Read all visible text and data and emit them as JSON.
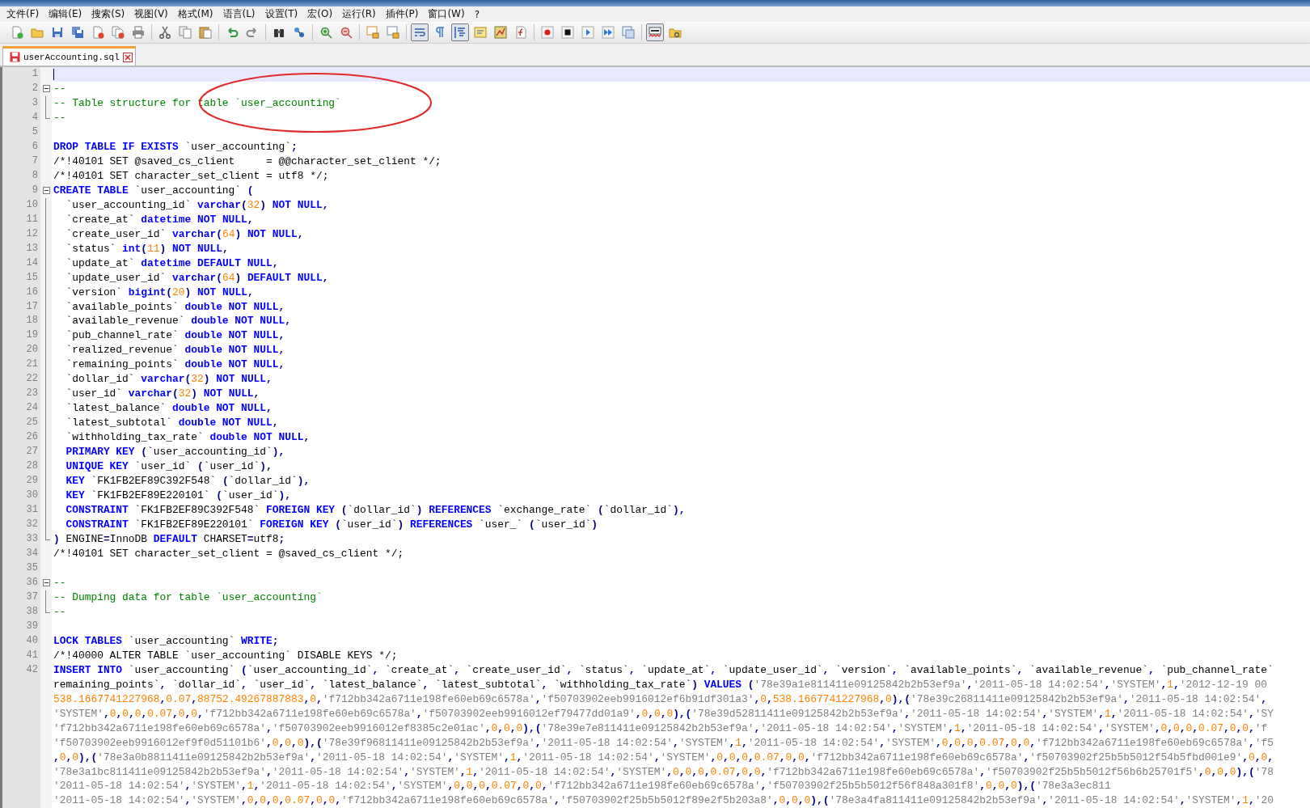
{
  "menu": [
    {
      "label": "文件(F)"
    },
    {
      "label": "编辑(E)"
    },
    {
      "label": "搜索(S)"
    },
    {
      "label": "视图(V)"
    },
    {
      "label": "格式(M)"
    },
    {
      "label": "语言(L)"
    },
    {
      "label": "设置(T)"
    },
    {
      "label": "宏(O)"
    },
    {
      "label": "运行(R)"
    },
    {
      "label": "插件(P)"
    },
    {
      "label": "窗口(W)"
    },
    {
      "label": "?"
    }
  ],
  "toolbar": [
    {
      "kind": "new",
      "pressed": false
    },
    {
      "kind": "open",
      "pressed": false
    },
    {
      "kind": "save",
      "pressed": false
    },
    {
      "kind": "saveall",
      "pressed": false
    },
    {
      "kind": "close",
      "pressed": false
    },
    {
      "kind": "closeall",
      "pressed": false
    },
    {
      "kind": "print",
      "pressed": false
    },
    {
      "kind": "separator"
    },
    {
      "kind": "cut",
      "pressed": false
    },
    {
      "kind": "copy",
      "pressed": false
    },
    {
      "kind": "paste",
      "pressed": false
    },
    {
      "kind": "separator"
    },
    {
      "kind": "undo",
      "pressed": false
    },
    {
      "kind": "redo",
      "pressed": false
    },
    {
      "kind": "separator"
    },
    {
      "kind": "find",
      "pressed": false
    },
    {
      "kind": "replace",
      "pressed": false
    },
    {
      "kind": "separator"
    },
    {
      "kind": "zoomin",
      "pressed": false
    },
    {
      "kind": "zoomout",
      "pressed": false
    },
    {
      "kind": "separator"
    },
    {
      "kind": "syncv",
      "pressed": false
    },
    {
      "kind": "synch",
      "pressed": false
    },
    {
      "kind": "separator"
    },
    {
      "kind": "wrap",
      "pressed": true
    },
    {
      "kind": "pilcrow",
      "pressed": false
    },
    {
      "kind": "indent",
      "pressed": true
    },
    {
      "kind": "udl",
      "pressed": false
    },
    {
      "kind": "map",
      "pressed": false
    },
    {
      "kind": "func",
      "pressed": false
    },
    {
      "kind": "separator"
    },
    {
      "kind": "record",
      "pressed": false
    },
    {
      "kind": "stop",
      "pressed": false
    },
    {
      "kind": "play",
      "pressed": false
    },
    {
      "kind": "playmulti",
      "pressed": false
    },
    {
      "kind": "savemacro",
      "pressed": false
    },
    {
      "kind": "separator"
    },
    {
      "kind": "spell",
      "pressed": true
    },
    {
      "kind": "extra",
      "pressed": false
    }
  ],
  "tabs": [
    {
      "label": "userAccounting.sql",
      "selected": true,
      "modified": true
    }
  ],
  "lines": [
    {
      "n": "1",
      "current": true
    },
    {
      "n": "2",
      "current": false,
      "kind": "open",
      "segs": [
        {
          "kind": "comment",
          "text": "--"
        }
      ]
    },
    {
      "n": "3",
      "current": false,
      "kind": "line",
      "segs": [
        {
          "kind": "comment",
          "text": "-- Table structure for table `user_accounting`"
        }
      ]
    },
    {
      "n": "4",
      "current": false,
      "kind": "end",
      "segs": [
        {
          "kind": "comment",
          "text": "--"
        }
      ]
    },
    {
      "n": "5",
      "current": false
    },
    {
      "n": "6",
      "current": false,
      "segs": [
        {
          "kind": "kw",
          "text": "DROP TABLE IF EXISTS"
        },
        {
          "kind": "code",
          "text": " `user_accounting`;"
        }
      ]
    },
    {
      "n": "7",
      "current": false,
      "segs": [
        {
          "kind": "text",
          "text": "/*!40101 SET @saved_cs_client     = @@character_set_client */;"
        }
      ]
    },
    {
      "n": "8",
      "current": false,
      "segs": [
        {
          "kind": "text",
          "text": "/*!40101 SET character_set_client = utf8 */;"
        }
      ]
    },
    {
      "n": "9",
      "current": false,
      "kind": "open",
      "segs": [
        {
          "kind": "kw",
          "text": "CREATE TABLE"
        },
        {
          "kind": "code",
          "text": " `user_accounting` ("
        }
      ]
    },
    {
      "n": "10",
      "current": false,
      "kind": "line",
      "segs": [
        {
          "kind": "code",
          "text": "  `user_accounting_id` "
        },
        {
          "kind": "kw",
          "text": "varchar"
        },
        {
          "kind": "code",
          "text": "(32) "
        },
        {
          "kind": "kw",
          "text": "NOT NULL"
        },
        {
          "kind": "code",
          "text": ","
        }
      ]
    },
    {
      "n": "11",
      "current": false,
      "kind": "line",
      "segs": [
        {
          "kind": "code",
          "text": "  `create_at` "
        },
        {
          "kind": "kw",
          "text": "datetime NOT NULL"
        },
        {
          "kind": "code",
          "text": ","
        }
      ]
    },
    {
      "n": "12",
      "current": false,
      "kind": "line",
      "segs": [
        {
          "kind": "code",
          "text": "  `create_user_id` "
        },
        {
          "kind": "kw",
          "text": "varchar"
        },
        {
          "kind": "code",
          "text": "(64) "
        },
        {
          "kind": "kw",
          "text": "NOT NULL"
        },
        {
          "kind": "code",
          "text": ","
        }
      ]
    },
    {
      "n": "13",
      "current": false,
      "kind": "line",
      "segs": [
        {
          "kind": "code",
          "text": "  `status` "
        },
        {
          "kind": "kw",
          "text": "int"
        },
        {
          "kind": "code",
          "text": "(11) "
        },
        {
          "kind": "kw",
          "text": "NOT NULL"
        },
        {
          "kind": "code",
          "text": ","
        }
      ]
    },
    {
      "n": "14",
      "current": false,
      "kind": "line",
      "segs": [
        {
          "kind": "code",
          "text": "  `update_at` "
        },
        {
          "kind": "kw",
          "text": "datetime DEFAULT NULL"
        },
        {
          "kind": "code",
          "text": ","
        }
      ]
    },
    {
      "n": "15",
      "current": false,
      "kind": "line",
      "segs": [
        {
          "kind": "code",
          "text": "  `update_user_id` "
        },
        {
          "kind": "kw",
          "text": "varchar"
        },
        {
          "kind": "code",
          "text": "(64) "
        },
        {
          "kind": "kw",
          "text": "DEFAULT NULL"
        },
        {
          "kind": "code",
          "text": ","
        }
      ]
    },
    {
      "n": "16",
      "current": false,
      "kind": "line",
      "segs": [
        {
          "kind": "code",
          "text": "  `version` "
        },
        {
          "kind": "kw",
          "text": "bigint"
        },
        {
          "kind": "code",
          "text": "(20) "
        },
        {
          "kind": "kw",
          "text": "NOT NULL"
        },
        {
          "kind": "code",
          "text": ","
        }
      ]
    },
    {
      "n": "17",
      "current": false,
      "kind": "line",
      "segs": [
        {
          "kind": "code",
          "text": "  `available_points` "
        },
        {
          "kind": "kw",
          "text": "double NOT NULL"
        },
        {
          "kind": "code",
          "text": ","
        }
      ]
    },
    {
      "n": "18",
      "current": false,
      "kind": "line",
      "segs": [
        {
          "kind": "code",
          "text": "  `available_revenue` "
        },
        {
          "kind": "kw",
          "text": "double NOT NULL"
        },
        {
          "kind": "code",
          "text": ","
        }
      ]
    },
    {
      "n": "19",
      "current": false,
      "kind": "line",
      "segs": [
        {
          "kind": "code",
          "text": "  `pub_channel_rate` "
        },
        {
          "kind": "kw",
          "text": "double NOT NULL"
        },
        {
          "kind": "code",
          "text": ","
        }
      ]
    },
    {
      "n": "20",
      "current": false,
      "kind": "line",
      "segs": [
        {
          "kind": "code",
          "text": "  `realized_revenue` "
        },
        {
          "kind": "kw",
          "text": "double NOT NULL"
        },
        {
          "kind": "code",
          "text": ","
        }
      ]
    },
    {
      "n": "21",
      "current": false,
      "kind": "line",
      "segs": [
        {
          "kind": "code",
          "text": "  `remaining_points` "
        },
        {
          "kind": "kw",
          "text": "double NOT NULL"
        },
        {
          "kind": "code",
          "text": ","
        }
      ]
    },
    {
      "n": "22",
      "current": false,
      "kind": "line",
      "segs": [
        {
          "kind": "code",
          "text": "  `dollar_id` "
        },
        {
          "kind": "kw",
          "text": "varchar"
        },
        {
          "kind": "code",
          "text": "(32) "
        },
        {
          "kind": "kw",
          "text": "NOT NULL"
        },
        {
          "kind": "code",
          "text": ","
        }
      ]
    },
    {
      "n": "23",
      "current": false,
      "kind": "line",
      "segs": [
        {
          "kind": "code",
          "text": "  `user_id` "
        },
        {
          "kind": "kw",
          "text": "varchar"
        },
        {
          "kind": "code",
          "text": "(32) "
        },
        {
          "kind": "kw",
          "text": "NOT NULL"
        },
        {
          "kind": "code",
          "text": ","
        }
      ]
    },
    {
      "n": "24",
      "current": false,
      "kind": "line",
      "segs": [
        {
          "kind": "code",
          "text": "  `latest_balance` "
        },
        {
          "kind": "kw",
          "text": "double NOT NULL"
        },
        {
          "kind": "code",
          "text": ","
        }
      ]
    },
    {
      "n": "25",
      "current": false,
      "kind": "line",
      "segs": [
        {
          "kind": "code",
          "text": "  `latest_subtotal` "
        },
        {
          "kind": "kw",
          "text": "double NOT NULL"
        },
        {
          "kind": "code",
          "text": ","
        }
      ]
    },
    {
      "n": "26",
      "current": false,
      "kind": "line",
      "segs": [
        {
          "kind": "code",
          "text": "  `withholding_tax_rate` "
        },
        {
          "kind": "kw",
          "text": "double NOT NULL"
        },
        {
          "kind": "code",
          "text": ","
        }
      ]
    },
    {
      "n": "27",
      "current": false,
      "kind": "line",
      "segs": [
        {
          "kind": "kw",
          "text": "  PRIMARY KEY"
        },
        {
          "kind": "code",
          "text": " (`user_accounting_id`),"
        }
      ]
    },
    {
      "n": "28",
      "current": false,
      "kind": "line",
      "segs": [
        {
          "kind": "kw",
          "text": "  UNIQUE KEY"
        },
        {
          "kind": "code",
          "text": " `user_id` (`user_id`),"
        }
      ]
    },
    {
      "n": "29",
      "current": false,
      "kind": "line",
      "segs": [
        {
          "kind": "kw",
          "text": "  KEY"
        },
        {
          "kind": "code",
          "text": " `FK1FB2EF89C392F548` (`dollar_id`),"
        }
      ]
    },
    {
      "n": "30",
      "current": false,
      "kind": "line",
      "segs": [
        {
          "kind": "kw",
          "text": "  KEY"
        },
        {
          "kind": "code",
          "text": " `FK1FB2EF89E220101` (`user_id`),"
        }
      ]
    },
    {
      "n": "31",
      "current": false,
      "kind": "line",
      "segs": [
        {
          "kind": "kw",
          "text": "  CONSTRAINT"
        },
        {
          "kind": "code",
          "text": " `FK1FB2EF89C392F548` "
        },
        {
          "kind": "kw",
          "text": "FOREIGN KEY"
        },
        {
          "kind": "code",
          "text": " (`dollar_id`) "
        },
        {
          "kind": "kw",
          "text": "REFERENCES"
        },
        {
          "kind": "code",
          "text": " `exchange_rate` (`dollar_id`),"
        }
      ]
    },
    {
      "n": "32",
      "current": false,
      "kind": "line",
      "segs": [
        {
          "kind": "kw",
          "text": "  CONSTRAINT"
        },
        {
          "kind": "code",
          "text": " `FK1FB2EF89E220101` "
        },
        {
          "kind": "kw",
          "text": "FOREIGN KEY"
        },
        {
          "kind": "code",
          "text": " (`user_id`) "
        },
        {
          "kind": "kw",
          "text": "REFERENCES"
        },
        {
          "kind": "code",
          "text": " `user_` (`user_id`)"
        }
      ]
    },
    {
      "n": "33",
      "current": false,
      "kind": "end",
      "segs": [
        {
          "kind": "code",
          "text": ") ENGINE=InnoDB "
        },
        {
          "kind": "kw",
          "text": "DEFAULT"
        },
        {
          "kind": "code",
          "text": " CHARSET=utf8;"
        }
      ]
    },
    {
      "n": "34",
      "current": false,
      "segs": [
        {
          "kind": "text",
          "text": "/*!40101 SET character_set_client = @saved_cs_client */;"
        }
      ]
    },
    {
      "n": "35",
      "current": false
    },
    {
      "n": "36",
      "current": false,
      "kind": "open",
      "segs": [
        {
          "kind": "comment",
          "text": "--"
        }
      ]
    },
    {
      "n": "37",
      "current": false,
      "kind": "line",
      "segs": [
        {
          "kind": "comment",
          "text": "-- Dumping data for table `user_accounting`"
        }
      ]
    },
    {
      "n": "38",
      "current": false,
      "kind": "end",
      "segs": [
        {
          "kind": "comment",
          "text": "--"
        }
      ]
    },
    {
      "n": "39",
      "current": false
    },
    {
      "n": "40",
      "current": false,
      "segs": [
        {
          "kind": "kw",
          "text": "LOCK TABLES"
        },
        {
          "kind": "code",
          "text": " `user_accounting` "
        },
        {
          "kind": "kw",
          "text": "WRITE"
        },
        {
          "kind": "code",
          "text": ";"
        }
      ]
    },
    {
      "n": "41",
      "current": false,
      "segs": [
        {
          "kind": "text",
          "text": "/*!40000 ALTER TABLE `user_accounting` DISABLE KEYS */;"
        }
      ]
    },
    {
      "n": "42",
      "current": false,
      "segs": [
        {
          "kind": "kw",
          "text": "INSERT INTO"
        },
        {
          "kind": "code",
          "text": " `user_accounting` (`user_accounting_id`, `create_at`, `create_user_id`, `status`, `update_at`, `update_user_id`, `version`, `available_points`, `available_revenue`, `pub_channel_rate`"
        }
      ]
    },
    {
      "current": false,
      "segs": [
        {
          "kind": "text",
          "text": "remaining_points`"
        },
        {
          "kind": "code",
          "text": ", `dollar_id`, `user_id`, `latest_balance`, `latest_subtotal`, `withholding_tax_rate`) "
        },
        {
          "kind": "kw",
          "text": "VALUES"
        },
        {
          "kind": "code",
          "text": " ('78e39a1e811411e09125842b2b53ef9a','2011-05-18 14:02:54','SYSTEM',1,'2012-12-19 00"
        }
      ]
    },
    {
      "current": false,
      "segs": [
        {
          "kind": "code",
          "text": "538.1667741227968,0.07,88752.49267887883,0,'f712bb342a6711e198fe60eb69c6578a','f50703902eeb9916012ef6b91df301a3',0,538.1667741227968,0),('78e39c26811411e09125842b2b53ef9a','2011-05-18 14:02:54',"
        }
      ]
    },
    {
      "current": false,
      "segs": [
        {
          "kind": "code",
          "text": "'SYSTEM',0,0,0,0.07,0,0,'f712bb342a6711e198fe60eb69c6578a','f50703902eeb9916012ef79477dd01a9',0,0,0),('78e39d52811411e09125842b2b53ef9a','2011-05-18 14:02:54','SYSTEM',1,'2011-05-18 14:02:54','SY"
        }
      ]
    },
    {
      "current": false,
      "segs": [
        {
          "kind": "code",
          "text": "'f712bb342a6711e198fe60eb69c6578a','f50703902eeb9916012ef8385c2e01ac',0,0,0),('78e39e7e811411e09125842b2b53ef9a','2011-05-18 14:02:54','SYSTEM',1,'2011-05-18 14:02:54','SYSTEM',0,0,0,0.07,0,0,'f"
        }
      ]
    },
    {
      "current": false,
      "segs": [
        {
          "kind": "code",
          "text": "'f50703902eeb9916012ef9f0d51101b6',0,0,0),('78e39f96811411e09125842b2b53ef9a','2011-05-18 14:02:54','SYSTEM',1,'2011-05-18 14:02:54','SYSTEM',0,0,0,0.07,0,0,'f712bb342a6711e198fe60eb69c6578a','f5"
        }
      ]
    },
    {
      "current": false,
      "segs": [
        {
          "kind": "code",
          "text": ",0,0),('78e3a0b8811411e09125842b2b53ef9a','2011-05-18 14:02:54','SYSTEM',1,'2011-05-18 14:02:54','SYSTEM',0,0,0,0.07,0,0,'f712bb342a6711e198fe60eb69c6578a','f50703902f25b5b5012f54b5fbd001e9',0,0,"
        }
      ]
    },
    {
      "current": false,
      "segs": [
        {
          "kind": "code",
          "text": "'78e3a1bc811411e09125842b2b53ef9a','2011-05-18 14:02:54','SYSTEM',1,'2011-05-18 14:02:54','SYSTEM',0,0,0,0.07,0,0,'f712bb342a6711e198fe60eb69c6578a','f50703902f25b5b5012f56b6b25701f5',0,0,0),('78"
        }
      ]
    },
    {
      "current": false,
      "segs": [
        {
          "kind": "code",
          "text": "'2011-05-18 14:02:54','SYSTEM',1,'2011-05-18 14:02:54','SYSTEM',0,0,0,0.07,0,0,'f712bb342a6711e198fe60eb69c6578a','f50703902f25b5b5012f56f848a301f8',0,0,0),('78e3a3ec811"
        }
      ]
    },
    {
      "current": false,
      "segs": [
        {
          "kind": "code",
          "text": "'2011-05-18 14:02:54','SYSTEM',0,0,0,0.07,0,0,'f712bb342a6711e198fe60eb69c6578a','f50703902f25b5b5012f89e2f5b203a8',0,0,0),('78e3a4fa811411e09125842b2b53ef9a','2011-05-18 14:02:54','SYSTEM',1,'20"
        }
      ]
    }
  ]
}
